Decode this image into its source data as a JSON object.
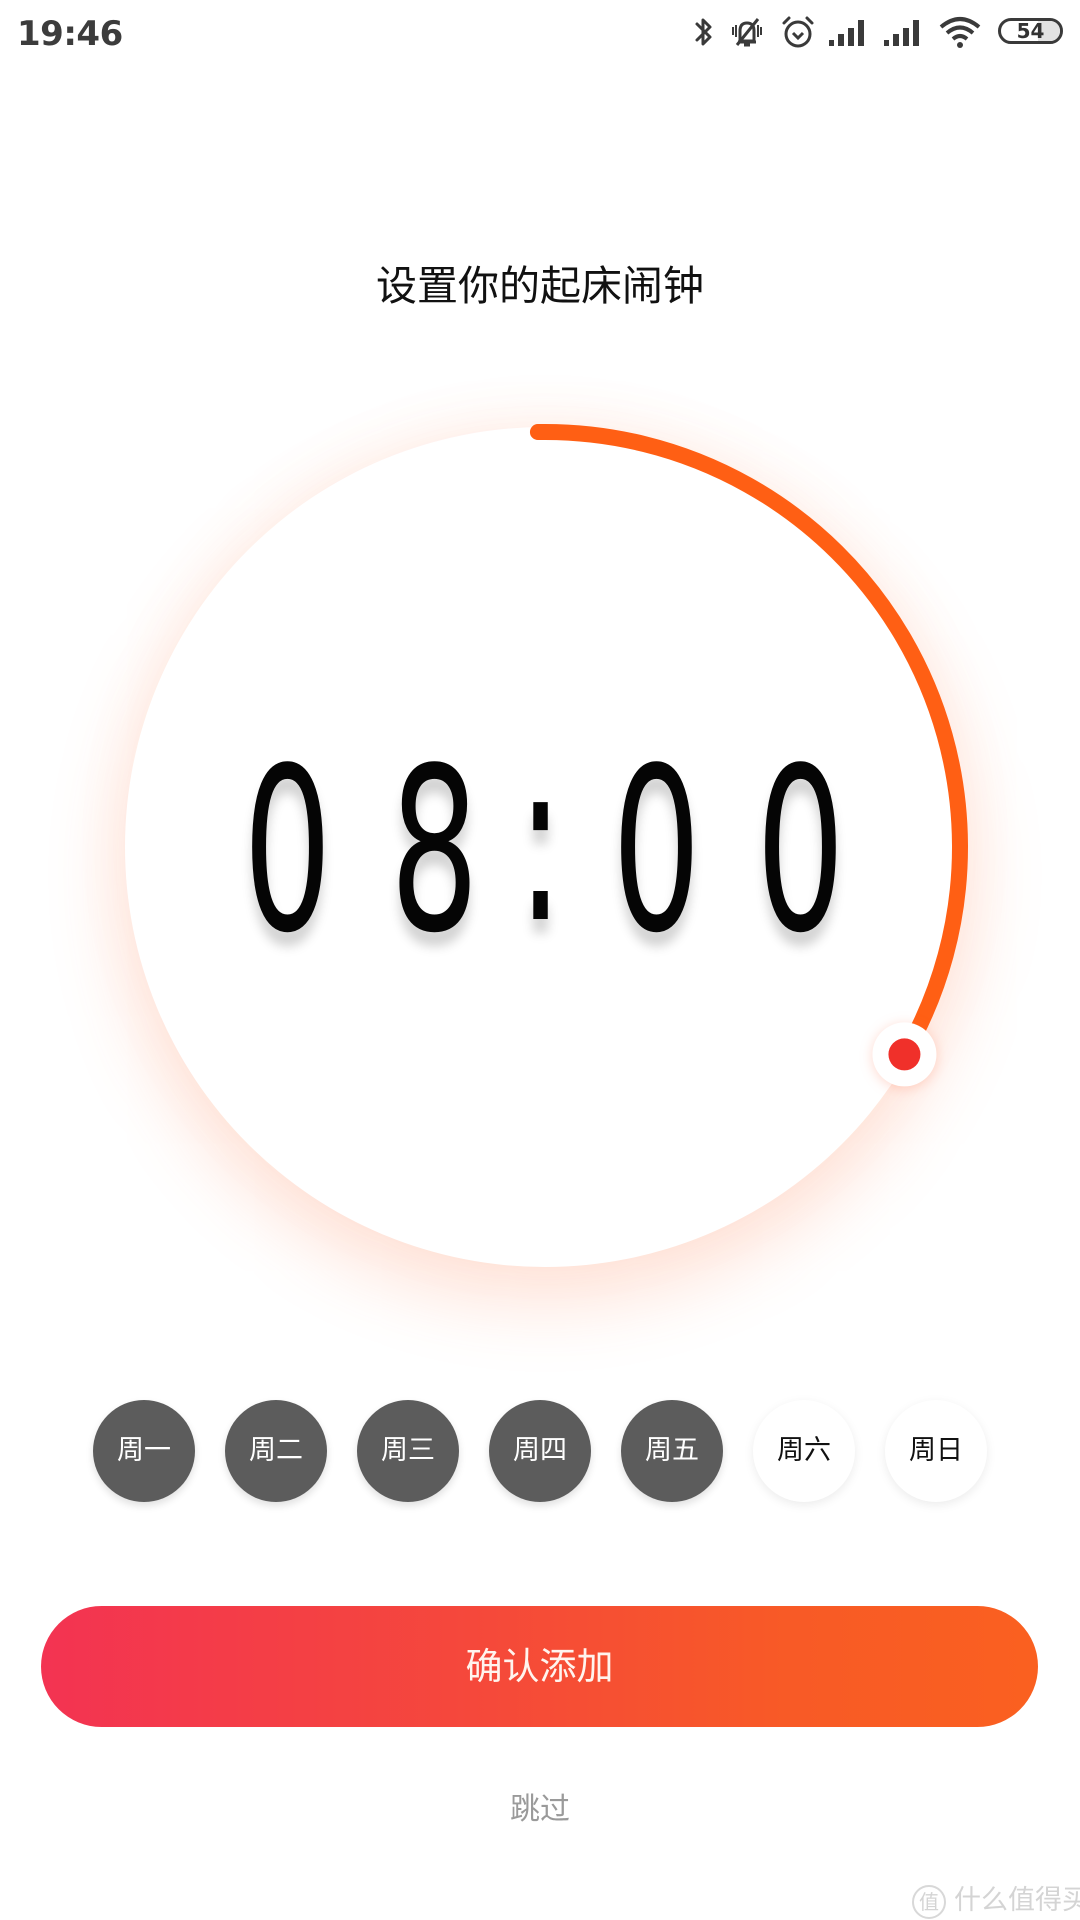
{
  "status_bar": {
    "time": "19:46",
    "icons": [
      "bluetooth-icon",
      "vibrate-muted-icon",
      "alarm-icon",
      "signal-icon",
      "signal-icon",
      "wifi-icon",
      "battery-icon"
    ],
    "battery_level": "54"
  },
  "page": {
    "title": "设置你的起床闹钟"
  },
  "alarm": {
    "time": "08:00",
    "hour": 8,
    "minute": 0,
    "dial_progress_fraction": 0.3333,
    "dial_scale_hours": 24,
    "accent_color": "#ff5f14",
    "knob_color": "#f0302a"
  },
  "days": [
    {
      "label": "周一",
      "selected": true
    },
    {
      "label": "周二",
      "selected": true
    },
    {
      "label": "周三",
      "selected": true
    },
    {
      "label": "周四",
      "selected": true
    },
    {
      "label": "周五",
      "selected": true
    },
    {
      "label": "周六",
      "selected": false
    },
    {
      "label": "周日",
      "selected": false
    }
  ],
  "actions": {
    "confirm_label": "确认添加",
    "skip_label": "跳过",
    "gradient_start": "#f33352",
    "gradient_end": "#fa6020"
  },
  "watermark": {
    "logo_char": "值",
    "text": "什么值得买"
  }
}
